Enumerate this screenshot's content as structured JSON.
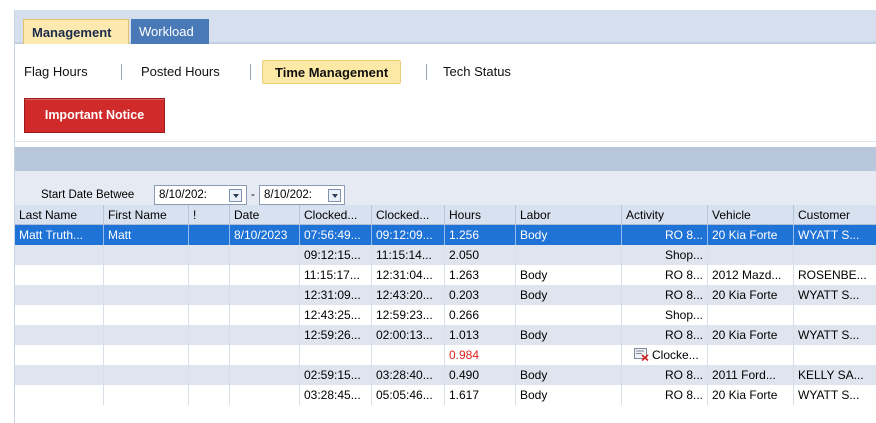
{
  "tabs": {
    "management": "Management",
    "workload": "Workload"
  },
  "subtabs": {
    "flag_hours": "Flag Hours",
    "posted_hours": "Posted Hours",
    "time_management": "Time Management",
    "tech_status": "Tech Status"
  },
  "notice": {
    "label": "Important Notice"
  },
  "filter": {
    "label": "Start Date Betwee",
    "from": "8/10/202:",
    "dash": "-",
    "to": "8/10/202:"
  },
  "columns": [
    "Last Name",
    "First Name",
    "!",
    "Date",
    "Clocked...",
    "Clocked...",
    "Hours",
    "Labor",
    "Activity",
    "Vehicle",
    "Customer"
  ],
  "rows": [
    {
      "last": "Matt Truth...",
      "first": "Matt",
      "flag": "",
      "date": "8/10/2023",
      "in": "07:56:49...",
      "out": "09:12:09...",
      "hours": "1.256",
      "labor": "Body",
      "activity": "RO 8...",
      "vehicle": "20 Kia Forte",
      "customer": "WYATT S..."
    },
    {
      "last": "",
      "first": "",
      "flag": "",
      "date": "",
      "in": "09:12:15...",
      "out": "11:15:14...",
      "hours": "2.050",
      "labor": "",
      "activity": "Shop...",
      "vehicle": "",
      "customer": ""
    },
    {
      "last": "",
      "first": "",
      "flag": "",
      "date": "",
      "in": "11:15:17...",
      "out": "12:31:04...",
      "hours": "1.263",
      "labor": "Body",
      "activity": "RO 8...",
      "vehicle": "2012 Mazd...",
      "customer": "ROSENBE..."
    },
    {
      "last": "",
      "first": "",
      "flag": "",
      "date": "",
      "in": "12:31:09...",
      "out": "12:43:20...",
      "hours": "0.203",
      "labor": "Body",
      "activity": "RO 8...",
      "vehicle": "20 Kia Forte",
      "customer": "WYATT S..."
    },
    {
      "last": "",
      "first": "",
      "flag": "",
      "date": "",
      "in": "12:43:25...",
      "out": "12:59:23...",
      "hours": "0.266",
      "labor": "",
      "activity": "Shop...",
      "vehicle": "",
      "customer": ""
    },
    {
      "last": "",
      "first": "",
      "flag": "",
      "date": "",
      "in": "12:59:26...",
      "out": "02:00:13...",
      "hours": "1.013",
      "labor": "Body",
      "activity": "RO 8...",
      "vehicle": "20 Kia Forte",
      "customer": "WYATT S..."
    },
    {
      "last": "",
      "first": "",
      "flag": "",
      "date": "",
      "in": "",
      "out": "",
      "hours": "0.984",
      "labor": "",
      "activity": "Clocke...",
      "vehicle": "",
      "customer": ""
    },
    {
      "last": "",
      "first": "",
      "flag": "",
      "date": "",
      "in": "02:59:15...",
      "out": "03:28:40...",
      "hours": "0.490",
      "labor": "Body",
      "activity": "RO 8...",
      "vehicle": "2011 Ford...",
      "customer": "KELLY SA..."
    },
    {
      "last": "",
      "first": "",
      "flag": "",
      "date": "",
      "in": "03:28:45...",
      "out": "05:05:46...",
      "hours": "1.617",
      "labor": "Body",
      "activity": "RO 8...",
      "vehicle": "20 Kia Forte",
      "customer": "WYATT S..."
    }
  ],
  "icons": {
    "clocked_out_row": "clock-error-icon",
    "dropdown": "chevron-down-icon"
  },
  "colors": {
    "selection": "#1f73d6",
    "notice": "#d12a2a",
    "active_tab": "#fce9a6",
    "warning_hours": "#e02020"
  }
}
